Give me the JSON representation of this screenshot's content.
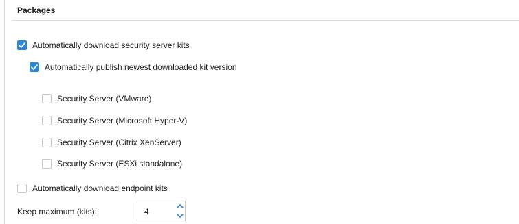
{
  "section": {
    "title": "Packages"
  },
  "options": {
    "auto_download_security_server": {
      "label": "Automatically download security server kits",
      "checked": true
    },
    "auto_publish_newest": {
      "label": "Automatically publish newest downloaded kit version",
      "checked": true
    },
    "security_servers": [
      {
        "label": "Security Server (VMware)",
        "checked": false
      },
      {
        "label": "Security Server (Microsoft Hyper-V)",
        "checked": false
      },
      {
        "label": "Security Server (Citrix XenServer)",
        "checked": false
      },
      {
        "label": "Security Server (ESXi standalone)",
        "checked": false
      }
    ],
    "auto_download_endpoint": {
      "label": "Automatically download endpoint kits",
      "checked": false
    }
  },
  "keep_maximum": {
    "label": "Keep maximum (kits):",
    "value": "4"
  },
  "colors": {
    "accent": "#2b86d9",
    "checkbox_border": "#c9c9c9",
    "divider": "#dcdcdc"
  },
  "icons": {
    "checkmark": "checkmark-icon",
    "spinner_up": "chevron-up-icon",
    "spinner_down": "chevron-down-icon"
  }
}
